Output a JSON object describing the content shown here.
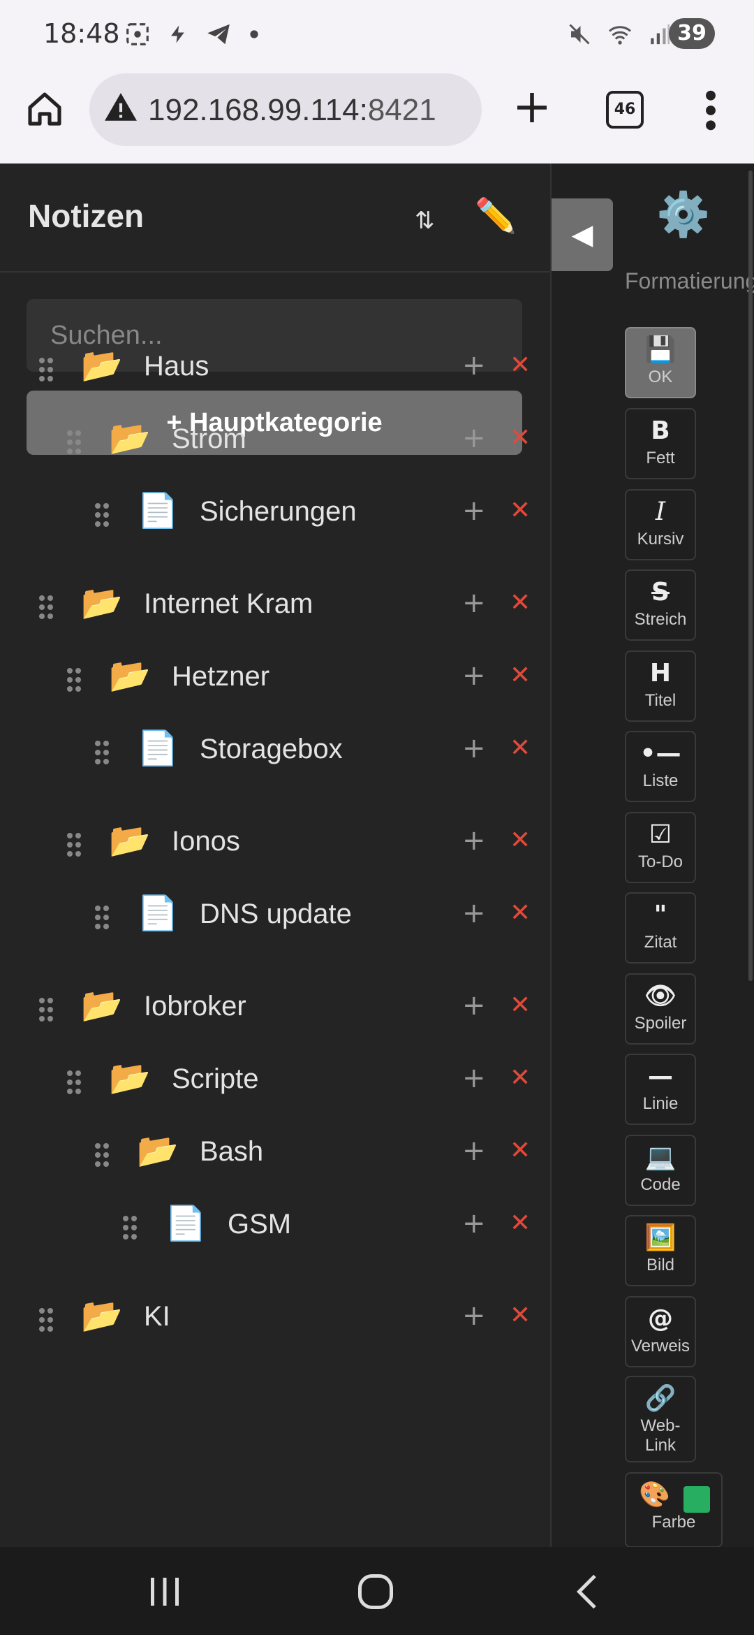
{
  "status_bar": {
    "time": "18:48",
    "left_icons": [
      "screenshot-icon",
      "flash-icon",
      "telegram-icon",
      "dot-icon"
    ],
    "right_icons": [
      "mute-icon",
      "wifi-icon",
      "signal-icon"
    ],
    "battery": "39"
  },
  "browser": {
    "url_host": "192.168.99.114:",
    "url_port": "8421",
    "tab_count": "46"
  },
  "notes": {
    "title": "Notizen",
    "sort_icon": "⇅",
    "edit_icon": "✏️",
    "search_placeholder": "Suchen...",
    "add_main_category": "+ Hauptkategorie",
    "add_symbol": "+",
    "delete_symbol": "✕",
    "items": [
      {
        "label": "Haus",
        "type": "folder",
        "level": 0
      },
      {
        "label": "Strom",
        "type": "folder",
        "level": 1
      },
      {
        "label": "Sicherungen",
        "type": "note",
        "level": 2
      },
      {
        "label": "Internet Kram",
        "type": "folder",
        "level": 0
      },
      {
        "label": "Hetzner",
        "type": "folder",
        "level": 1
      },
      {
        "label": "Storagebox",
        "type": "note",
        "level": 2
      },
      {
        "label": "Ionos",
        "type": "folder",
        "level": 1
      },
      {
        "label": "DNS update",
        "type": "note",
        "level": 2
      },
      {
        "label": "Iobroker",
        "type": "folder",
        "level": 0
      },
      {
        "label": "Scripte",
        "type": "folder",
        "level": 1
      },
      {
        "label": "Bash",
        "type": "folder",
        "level": 2
      },
      {
        "label": "GSM",
        "type": "note",
        "level": 3
      },
      {
        "label": "KI",
        "type": "folder",
        "level": 0
      }
    ],
    "folder_icon": "📂",
    "note_icon": "📄"
  },
  "formatting": {
    "collapse_icon": "◀",
    "settings_icon": "⚙️",
    "title": "Formatierung",
    "buttons": [
      {
        "icon": "💾",
        "label": "OK"
      },
      {
        "icon": "B",
        "label": "Fett"
      },
      {
        "icon": "I",
        "label": "Kursiv"
      },
      {
        "icon": "S",
        "label": "Streich"
      },
      {
        "icon": "H",
        "label": "Titel"
      },
      {
        "icon": "•—",
        "label": "Liste"
      },
      {
        "icon": "☑",
        "label": "To-Do"
      },
      {
        "icon": "\"",
        "label": "Zitat"
      },
      {
        "icon": "👁",
        "label": "Spoiler"
      },
      {
        "icon": "—",
        "label": "Linie"
      },
      {
        "icon": "💻",
        "label": "Code"
      },
      {
        "icon": "🖼️",
        "label": "Bild"
      },
      {
        "icon": "@",
        "label": "Verweis"
      },
      {
        "icon": "🔗",
        "label": "Web-\nLink"
      },
      {
        "icon": "🎨",
        "label": "Farbe"
      }
    ],
    "color_swatch": "#27ae60"
  },
  "colors": {
    "delete": "#e04a3a",
    "panel_bg": "#242424"
  }
}
